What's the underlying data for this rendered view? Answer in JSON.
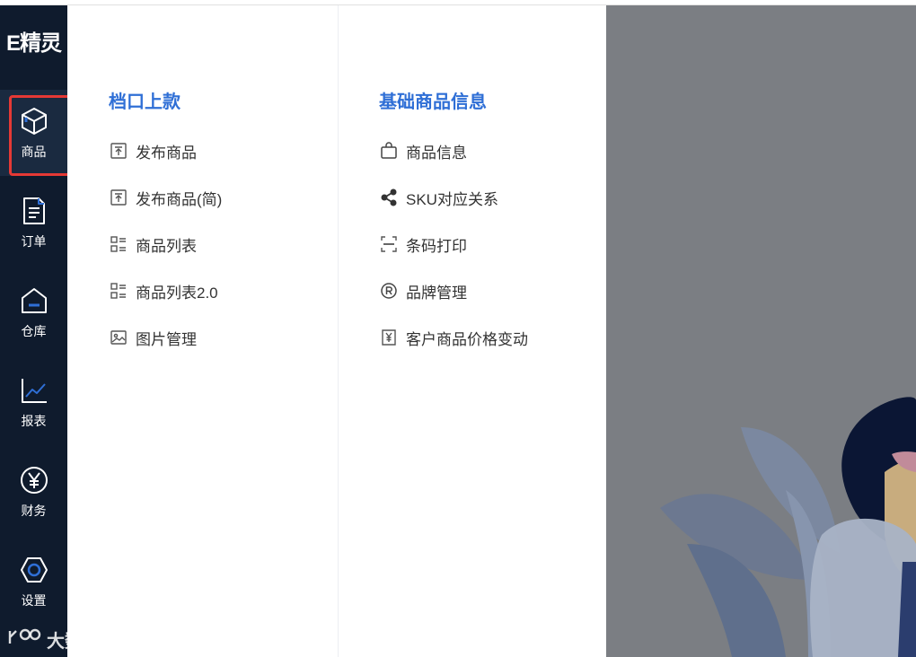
{
  "app": {
    "logo": "E精灵"
  },
  "rail": {
    "items": [
      {
        "label": "商品",
        "icon": "box-icon",
        "active": true
      },
      {
        "label": "订单",
        "icon": "document-icon"
      },
      {
        "label": "仓库",
        "icon": "warehouse-icon"
      },
      {
        "label": "报表",
        "icon": "line-chart-icon"
      },
      {
        "label": "财务",
        "icon": "yen-circle-icon"
      },
      {
        "label": "设置",
        "icon": "hexagon-settings-icon"
      }
    ]
  },
  "menu": {
    "col1": {
      "title": "档口上款",
      "items": [
        {
          "label": "发布商品",
          "icon": "upload-doc-icon"
        },
        {
          "label": "发布商品(简)",
          "icon": "upload-doc-icon"
        },
        {
          "label": "商品列表",
          "icon": "list-icon"
        },
        {
          "label": "商品列表2.0",
          "icon": "list-icon"
        },
        {
          "label": "图片管理",
          "icon": "image-icon"
        }
      ]
    },
    "col2": {
      "title": "基础商品信息",
      "items": [
        {
          "label": "商品信息",
          "icon": "shopping-bag-icon"
        },
        {
          "label": "SKU对应关系",
          "icon": "share-icon"
        },
        {
          "label": "条码打印",
          "icon": "barcode-scan-icon"
        },
        {
          "label": "品牌管理",
          "icon": "registered-icon"
        },
        {
          "label": "客户商品价格变动",
          "icon": "yen-doc-icon"
        }
      ]
    }
  },
  "watermark": {
    "text": "大数跨境"
  },
  "colors": {
    "rail_bg": "#0f1b2d",
    "accent": "#2f6fd6",
    "highlight": "#e53935"
  }
}
